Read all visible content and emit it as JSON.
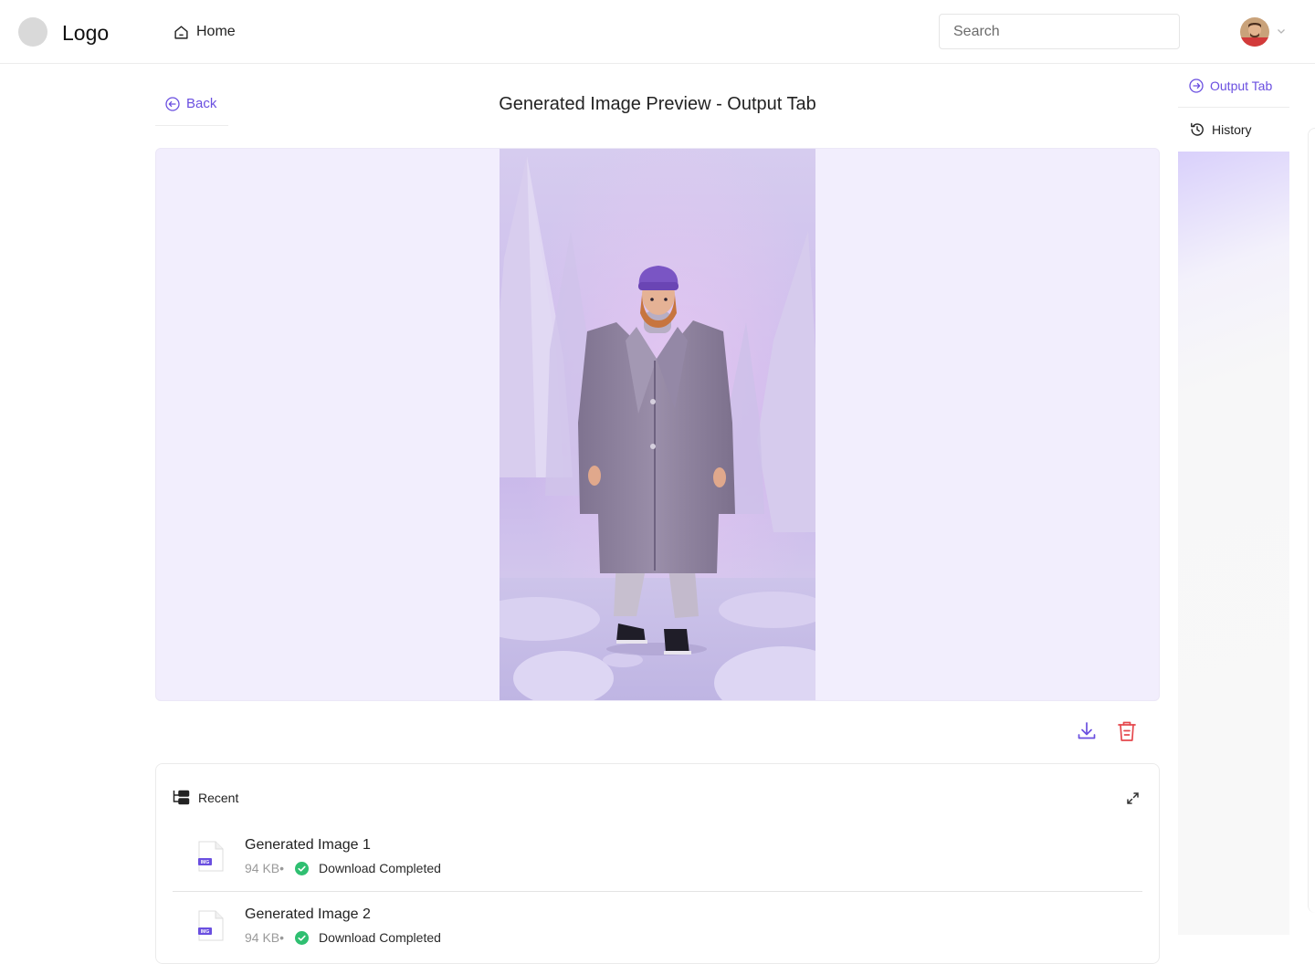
{
  "header": {
    "logo_text": "Logo",
    "nav_home_label": "Home",
    "search_placeholder": "Search"
  },
  "main": {
    "back_label": "Back",
    "title": "Generated Image Preview - Output Tab"
  },
  "tabs": {
    "output_label": "Output Tab",
    "history_label": "History"
  },
  "recent": {
    "title": "Recent",
    "files": [
      {
        "name": "Generated Image 1",
        "size": "94 KB•",
        "status": "Download Completed",
        "badge": "IMG"
      },
      {
        "name": "Generated Image 2",
        "size": "94 KB•",
        "status": "Download Completed",
        "badge": "IMG"
      }
    ]
  },
  "colors": {
    "accent": "#6a4fe0",
    "danger": "#e5484d",
    "success": "#2fbf71",
    "preview_bg": "#f2eefd"
  },
  "icons": {
    "home": "home-icon",
    "back": "arrow-left-circle-icon",
    "output": "arrow-right-circle-icon",
    "history": "history-icon",
    "download": "download-icon",
    "delete": "trash-icon",
    "recent": "folder-tree-icon",
    "expand": "expand-icon",
    "file": "image-file-icon",
    "check": "check-circle-icon"
  }
}
